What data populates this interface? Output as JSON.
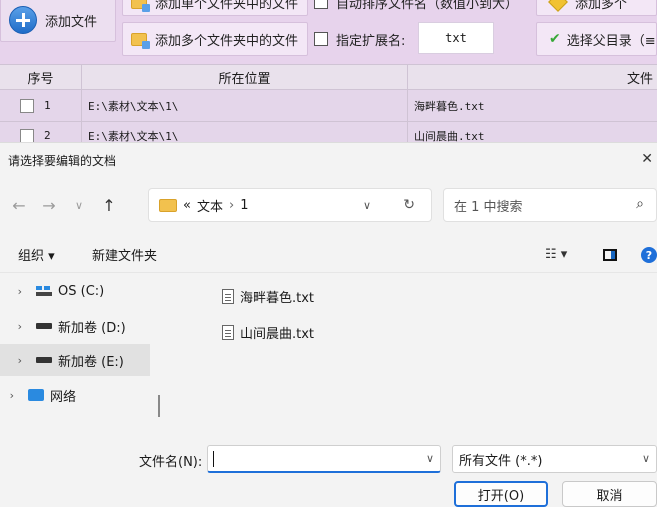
{
  "app": {
    "toolbar": {
      "add_file": "添加文件",
      "add_single_folder": "添加单个文件夹中的文件",
      "auto_sort": "自动排序文件名（数值小到大）",
      "add_more": "添加多个",
      "add_multi_folder": "添加多个文件夹中的文件",
      "ext_label": "指定扩展名:",
      "ext_value": "txt",
      "select_parent": "选择父目录（≡"
    },
    "grid": {
      "headers": [
        "序号",
        "所在位置",
        "文件"
      ],
      "rows": [
        {
          "index": "1",
          "location": "E:\\素材\\文本\\1\\",
          "filename": "海畔暮色.txt"
        },
        {
          "index": "2",
          "location": "E:\\素材\\文本\\1\\",
          "filename": "山间晨曲.txt"
        }
      ]
    }
  },
  "dialog": {
    "title": "请选择要编辑的文档",
    "close": "✕",
    "breadcrumb": {
      "prefix": "«",
      "parent": "文本",
      "current": "1"
    },
    "search_placeholder": "在 1 中搜索",
    "commands": {
      "organize": "组织 ▾",
      "new_folder": "新建文件夹",
      "view": "☷ ▾",
      "help": "?"
    },
    "nav_items": [
      {
        "label": "OS (C:)",
        "icon": "os-drive-icon",
        "selected": false
      },
      {
        "label": "新加卷 (D:)",
        "icon": "drive-icon",
        "selected": false
      },
      {
        "label": "新加卷 (E:)",
        "icon": "drive-icon",
        "selected": true
      },
      {
        "label": "网络",
        "icon": "network-icon",
        "selected": false
      }
    ],
    "files": [
      "海畔暮色.txt",
      "山间晨曲.txt"
    ],
    "filename_label": "文件名(N):",
    "filename_value": "",
    "filetype": "所有文件 (*.*)",
    "open_button": "打开(O)",
    "cancel_button": "取消"
  }
}
